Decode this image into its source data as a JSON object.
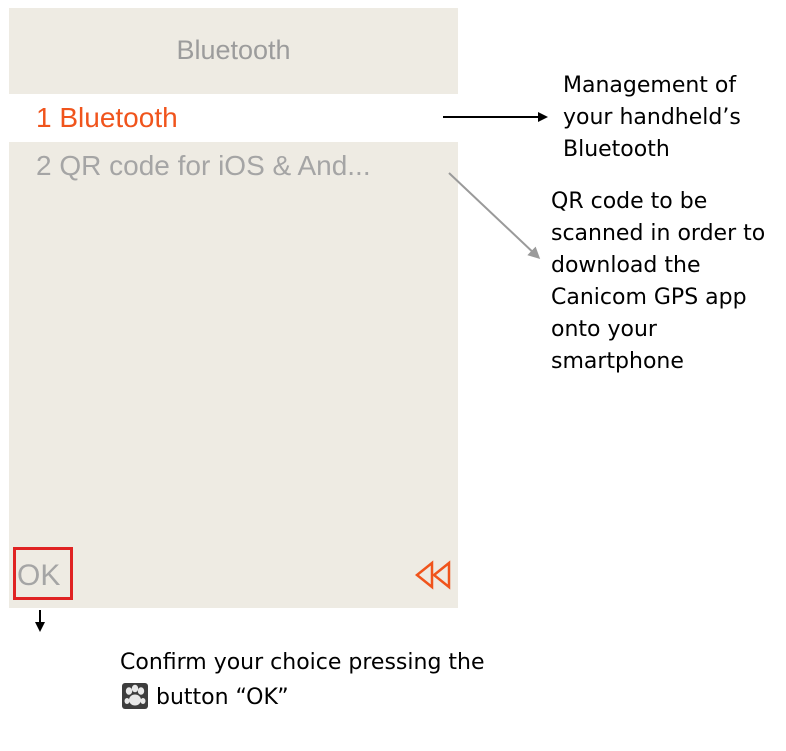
{
  "screen": {
    "title": "Bluetooth",
    "menu": [
      {
        "label": "1 Bluetooth",
        "selected": true
      },
      {
        "label": "2 QR code for iOS & And...",
        "selected": false
      }
    ],
    "ok_label": "OK",
    "back_icon": "double-chevron-left-icon",
    "colors": {
      "background": "#eeebe3",
      "accent": "#f0541c",
      "muted_text": "#a5a5a5",
      "highlight_box": "#e02323"
    }
  },
  "annotations": {
    "bluetooth_note": "Management of your handheld’s Bluetooth",
    "qr_note": "QR code to be scanned in order to download the Canicom GPS app onto your smartphone",
    "confirm_line1": "Confirm your choice pressing the",
    "confirm_line2": "button “OK”",
    "paw_icon": "paw-button-icon"
  }
}
